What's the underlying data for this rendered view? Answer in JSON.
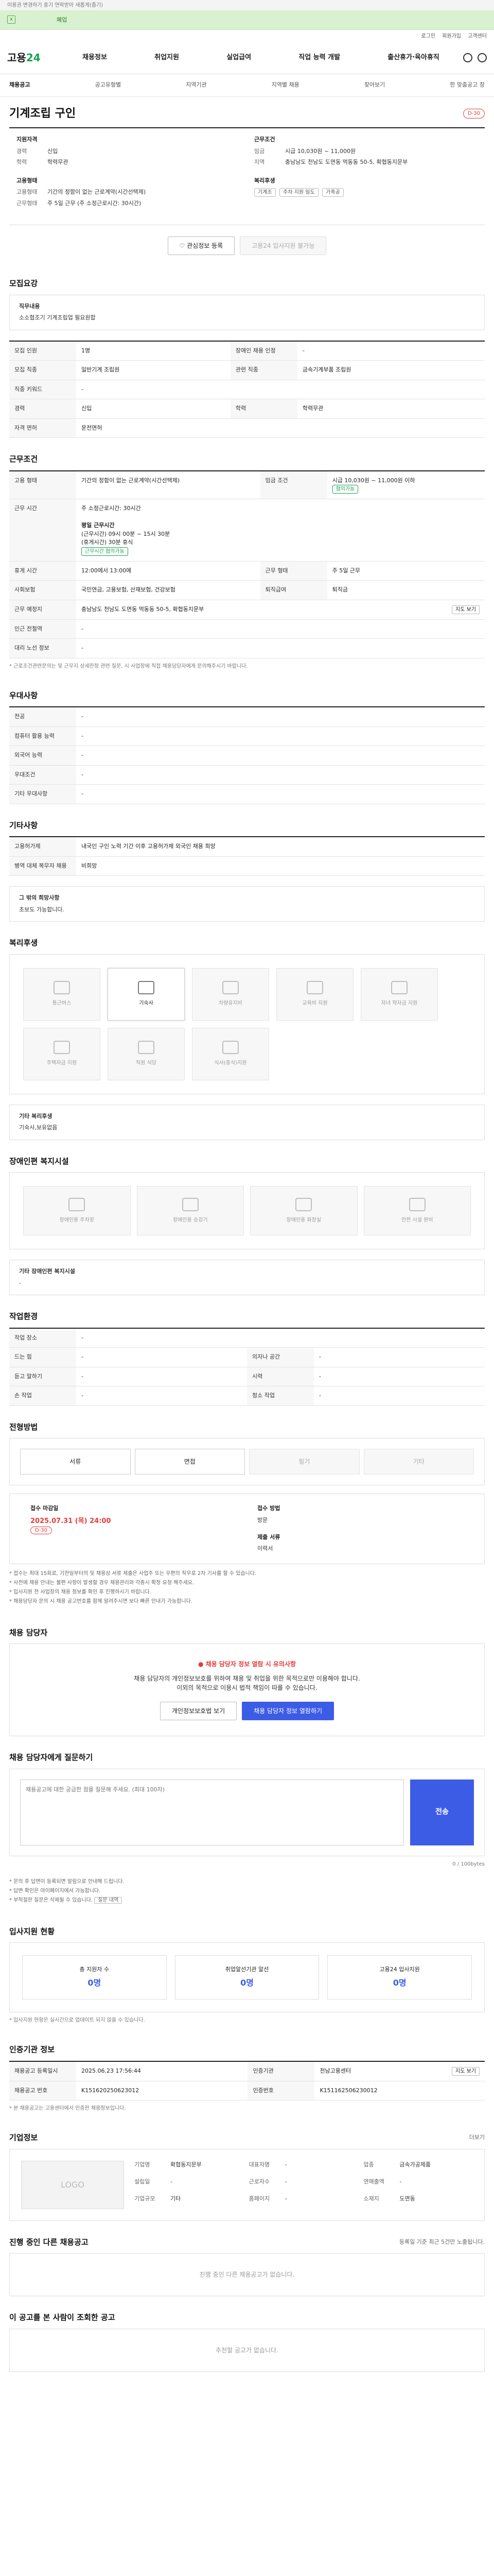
{
  "notice": "이용권 변경하기 중기 연락받아 새롭게(줍기)",
  "banner": {
    "close": "x",
    "text": "폐업"
  },
  "util": [
    "로그인",
    "회원가입",
    "고객센터"
  ],
  "gnb": {
    "logo_a": "고용",
    "logo_b": "24",
    "menu": [
      "채용정보",
      "취업지원",
      "실업급여",
      "직업 능력 개발",
      "출산휴가·육아휴직"
    ]
  },
  "sub": [
    "채용공고",
    "공고유형별",
    "지역기관",
    "지역별 채용",
    "찾아보기",
    "한 맞춤공고 창"
  ],
  "job": {
    "title": "기계조립 구인",
    "dday": "D-30"
  },
  "summary": {
    "left_title": "지원자격",
    "left": [
      {
        "k": "경력",
        "v": "신입"
      },
      {
        "k": "학력",
        "v": "학력무관"
      }
    ],
    "right_title": "근무조건",
    "right": [
      {
        "k": "임금",
        "v": "시급 10,030원 ~ 11,000원"
      },
      {
        "k": "지역",
        "v": "충남남도 천남도 도면동 먹동동 50-5, 확협동지문부"
      }
    ],
    "left2_title": "고용형태",
    "left2": [
      {
        "k": "고용형태",
        "v": "기간의 정함이 없는 근로계약(시간선택제)"
      },
      {
        "k": "근무형태",
        "v": "주 5일 근무 (주 소정근로시간: 30시간)"
      }
    ],
    "right2_title": "복리후생",
    "right2_tags": [
      "기계조",
      "주차 지원 일도",
      "가족공"
    ]
  },
  "actions": {
    "scrap": "관심정보 등록",
    "apply": "고용24 입사지원 불가능"
  },
  "recruit": {
    "title": "모집요강",
    "box_title": "직무내용",
    "box_text": "소소협조기 기계조립업 필요원합",
    "rows": [
      {
        "k": "모집 인원",
        "v": "1명",
        "k2": "장애인 채용 인정",
        "v2": "-"
      },
      {
        "k": "모집 직종",
        "v": "일반기계 조립원",
        "k2": "관련 직종",
        "v2": "금속기계부품 조립원"
      },
      {
        "k": "직종 키워드",
        "v": "-",
        "k2": "",
        "v2": ""
      },
      {
        "k": "경력",
        "v": "신입",
        "k2": "학력",
        "v2": "학력무관"
      },
      {
        "k": "자격 면허",
        "v": "운전면허",
        "k2": "",
        "v2": ""
      }
    ]
  },
  "work": {
    "title": "근무조건",
    "r1": {
      "k": "고용 형태",
      "v": "기간의 정함이 없는 근로계약(시간선택제)",
      "k2": "임금 조건",
      "v2": "시급 10,030원 ~ 11,000원 이하",
      "tag": "협의가능"
    },
    "r2": {
      "k": "근무 시간",
      "v": "주 소정근로시간: 30시간",
      "d1": "평일 근무시간",
      "d2": "(근무시간) 09시 00분 ~ 15시 30분",
      "d3": "(휴게시간) 30분 휴식",
      "tag": "근무시간 협의가능"
    },
    "r3": {
      "k": "휴게 시간",
      "v": "12:00에서 13:00에",
      "k2": "근무 형태",
      "v2": "주 5일 근무"
    },
    "r4": {
      "k": "사회보험",
      "v": "국민연금, 고용보험, 산재보험, 건강보험",
      "k2": "퇴직급여",
      "v2": "퇴직금"
    },
    "r5": {
      "k": "근무 예정지",
      "v": "충남남도 천남도 도면동 먹동동 50-5, 확협동지문부",
      "btn": "지도 보기"
    },
    "r6": {
      "k": "인근 전철역",
      "v": "-"
    },
    "r7": {
      "k": "대리 노선 정보",
      "v": "-"
    },
    "note": "* 근로조건관련문의는 및 근무지 상세한정 관련 질문, 시 사업장에 직접 채용담당자에게 문의해주시기 바랍니다."
  },
  "pref": {
    "title": "우대사항",
    "rows": [
      {
        "k": "전공",
        "v": "-"
      },
      {
        "k": "컴퓨터 활용 능력",
        "v": "-"
      },
      {
        "k": "외국어 능력",
        "v": "-"
      },
      {
        "k": "우대조건",
        "v": "-"
      },
      {
        "k": "기타 우대사항",
        "v": "-"
      }
    ]
  },
  "etc": {
    "title": "기타사항",
    "rows": [
      {
        "k": "고용허가제",
        "v": "내국인 구인 노력 기간 이후 고용허가제 외국인 채용 희망"
      },
      {
        "k": "병역 대체 복무자 채용",
        "v": "비희망"
      }
    ],
    "box_title": "그 밖의 희망사항",
    "box_text": "초보도 가능합니다."
  },
  "benefits": {
    "title": "복리후생",
    "items": [
      "통근버스",
      "기숙사",
      "차량유지비",
      "교육비 지원",
      "자녀 학자금 지원",
      "주택자금 지원",
      "직원 식당",
      "식사(중식)지원"
    ],
    "active": 1,
    "box_title": "기타 복리후생",
    "box_text": "기숙사,보유없음"
  },
  "disab": {
    "title": "장애인편 복지시설",
    "items": [
      "장애인용 주차장",
      "장애인용 승강기",
      "장애인용 화장실",
      "안전 시설 완비"
    ],
    "box_title": "기타 장애인편 복지시설",
    "box_text": "-"
  },
  "env": {
    "title": "작업환경",
    "rows": [
      {
        "k": "작업 장소",
        "v": "-",
        "k2": "",
        "v2": ""
      },
      {
        "k": "드는 힘",
        "v": "-",
        "k2": "의자나 공간",
        "v2": "-"
      },
      {
        "k": "듣고 말하기",
        "v": "-",
        "k2": "시력",
        "v2": "-"
      },
      {
        "k": "손 작업",
        "v": "-",
        "k2": "청소 작업",
        "v2": "-"
      }
    ]
  },
  "proc": {
    "title": "전형방법",
    "steps": [
      "서류",
      "면접",
      "필기",
      "기타"
    ],
    "deadline_label": "접수 마감일",
    "deadline": "2025.07.31 (목) 24:00",
    "dday": "D-30",
    "method_label": "접수 방법",
    "method_sub": "방문",
    "docs_label": "제출 서류",
    "docs": "이력서",
    "list": [
      "* 접수는 최대 15회로, 기한일부터의 및 채용상 서류 제출은 사업주 또는 우편의 직무로 2차 기사를 할 수 있습니다.",
      "* 사전에 채용 안내는 불편 사항이 발생할 경우 채용관리와 각종시 확정 요청 해주세요.",
      "* 입사지원 전 사업장의 채용 정보를 확인 후 진행하시기 바랍니다.",
      "* 채용담당자 문의 시 채용 공고번호를 함께 알려주시면 보다 빠른 안내가 가능합니다."
    ]
  },
  "contact": {
    "title": "채용 담당자",
    "warn": "채용 담당자 정보 열람 시 유의사항",
    "l1": "채용 담당자의 개인정보보호를 위하여 채용 및 취업을 위한 목적으로만 이용해야 합니다.",
    "l2": "이외의 목적으로 이용시 법적 책임이 따를 수 있습니다.",
    "b1": "개인정보보호법 보기",
    "b2": "채용 담당자 정보 열람하기"
  },
  "qna": {
    "title": "채용 담당자에게 질문하기",
    "placeholder": "채용공고에 대한 궁금한 점을 질문해 주세요. (최대 100자)",
    "count": "0 / 100bytes",
    "send": "전송",
    "list": [
      "* 문의 후 답변이 등록되면 알림으로 안내해 드립니다.",
      "* 답변 확인은 마이페이지에서 가능합니다.",
      "* 부적절한 질문은 삭제될 수 있습니다."
    ],
    "btn": "질문 내역"
  },
  "stats": {
    "title": "입사지원 현황",
    "items": [
      {
        "k": "총 지원자 수",
        "v": "0명"
      },
      {
        "k": "취업알선기관 알선",
        "v": "0명"
      },
      {
        "k": "고용24 입사지원",
        "v": "0명"
      }
    ],
    "note": "* 입사지원 현황은 실시간으로 업데이트 되지 않을 수 있습니다."
  },
  "org": {
    "title": "인증기관 정보",
    "rows": [
      {
        "k": "채용공고 등록일시",
        "v": "2025.06.23 17:56:44",
        "k2": "인증기관",
        "v2": "천남고용센터",
        "btn": "지도 보기"
      },
      {
        "k": "채용공고 번호",
        "v": "K151620250623012",
        "k2": "인증번호",
        "v2": "K151162506230012"
      }
    ],
    "note": "* 본 채용공고는 고용센터에서 인증한 채용정보입니다."
  },
  "company": {
    "title": "기업정보",
    "more": "더보기",
    "logo": "LOGO",
    "fields": [
      {
        "k": "기업명",
        "v": "확협동지문부"
      },
      {
        "k": "대표자명",
        "v": "-"
      },
      {
        "k": "업종",
        "v": "금속가공제품"
      },
      {
        "k": "설립일",
        "v": "-"
      },
      {
        "k": "근로자수",
        "v": "-"
      },
      {
        "k": "연매출액",
        "v": "-"
      },
      {
        "k": "기업규모",
        "v": "기타"
      },
      {
        "k": "홈페이지",
        "v": "-"
      },
      {
        "k": "소재지",
        "v": "도면동"
      }
    ]
  },
  "same": {
    "title": "진행 중인 다른 채용공고",
    "note": "등록일 기준 최근 5건만 노출됩니다.",
    "empty": "진행 중인 다른 채용공고가 없습니다."
  },
  "recommend": {
    "title": "이 공고를 본 사람이 조회한 공고",
    "empty": "추천할 공고가 없습니다."
  }
}
